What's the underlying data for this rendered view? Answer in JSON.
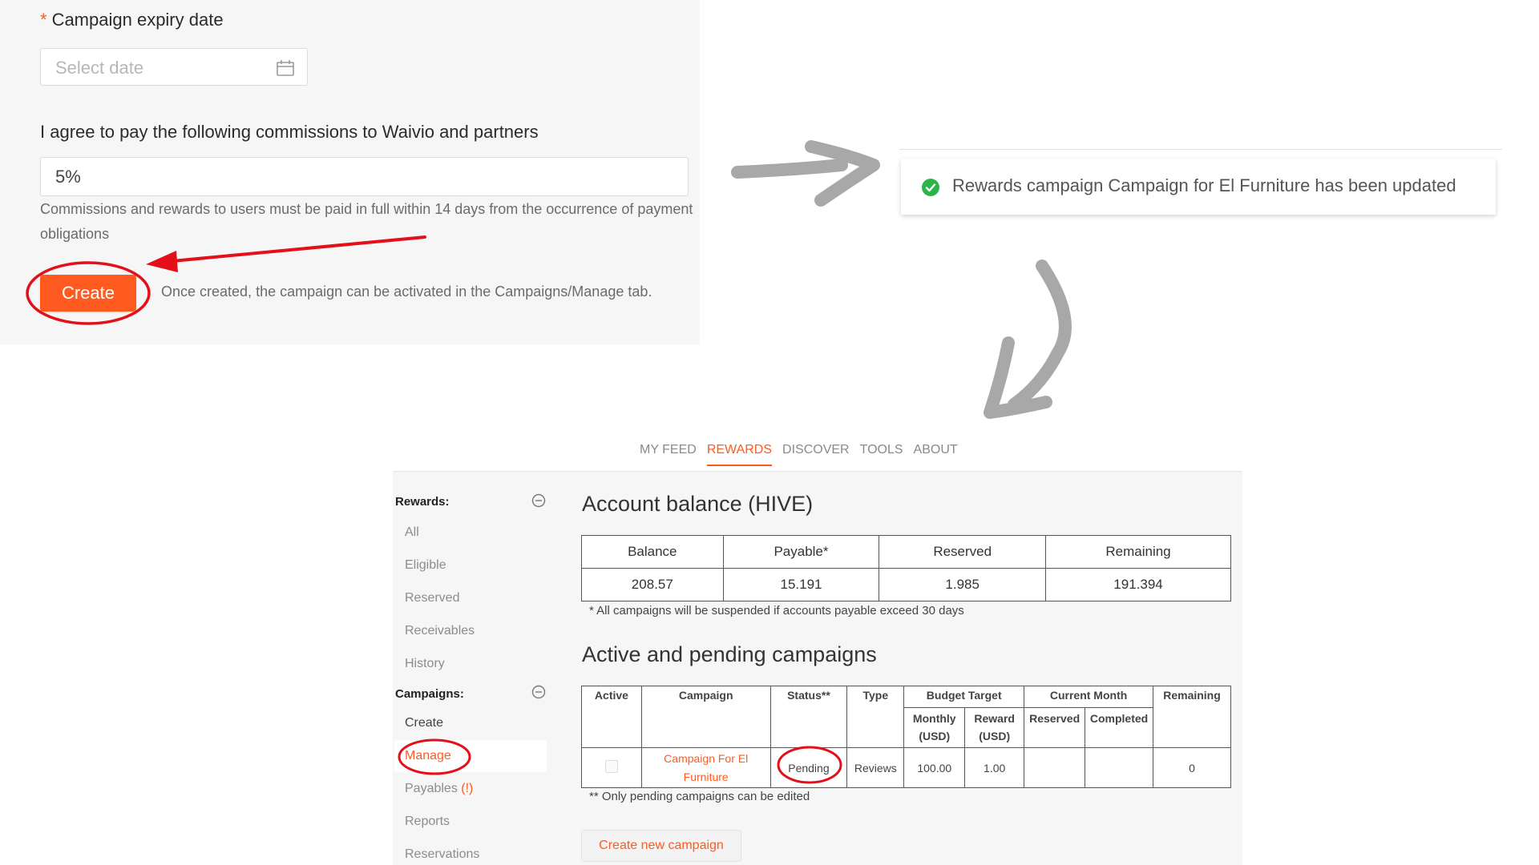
{
  "form": {
    "expiry_label": "Campaign expiry date",
    "required_mark": "*",
    "date_placeholder": "Select date",
    "commission_label": "I agree to pay the following commissions to Waivio and partners",
    "commission_value": "5%",
    "commission_note": "Commissions and rewards to users must be paid in full within 14 days from the occurrence of payment obligations",
    "create_button": "Create",
    "create_hint": "Once created, the campaign can be activated in the Campaigns/Manage tab."
  },
  "notification": {
    "message": "Rewards campaign Campaign for El Furniture has been updated",
    "status_color": "#2bb44a"
  },
  "topnav": {
    "items": [
      "MY FEED",
      "REWARDS",
      "DISCOVER",
      "TOOLS",
      "ABOUT"
    ],
    "active": "REWARDS"
  },
  "sidebar": {
    "rewards_title": "Rewards:",
    "rewards_items": [
      "All",
      "Eligible",
      "Reserved",
      "Receivables",
      "History"
    ],
    "campaigns_title": "Campaigns:",
    "campaigns_items": [
      "Create",
      "Manage",
      "Payables",
      "Reports",
      "Reservations"
    ],
    "payables_warning": "(!)"
  },
  "balance": {
    "title": "Account balance (HIVE)",
    "headers": [
      "Balance",
      "Payable*",
      "Reserved",
      "Remaining"
    ],
    "values": [
      "208.57",
      "15.191",
      "1.985",
      "191.394"
    ],
    "note": "* All campaigns will be suspended if accounts payable exceed 30 days"
  },
  "campaigns": {
    "title": "Active and pending campaigns",
    "headers": {
      "active": "Active",
      "campaign": "Campaign",
      "status": "Status**",
      "type": "Type",
      "budget_target": "Budget Target",
      "current_month": "Current Month",
      "remaining": "Remaining",
      "monthly": "Monthly (USD)",
      "reward": "Reward (USD)",
      "reserved": "Reserved",
      "completed": "Completed"
    },
    "row": {
      "campaign": "Campaign For El Furniture",
      "status": "Pending",
      "type": "Reviews",
      "monthly": "100.00",
      "reward": "1.00",
      "reserved": "",
      "completed": "",
      "remaining": "0"
    },
    "note": "** Only pending campaigns can be edited",
    "create_new": "Create new campaign"
  },
  "colors": {
    "accent": "#ff5a1f",
    "annotation_red": "#e3101a",
    "arrow_gray": "#a8a8a8"
  }
}
